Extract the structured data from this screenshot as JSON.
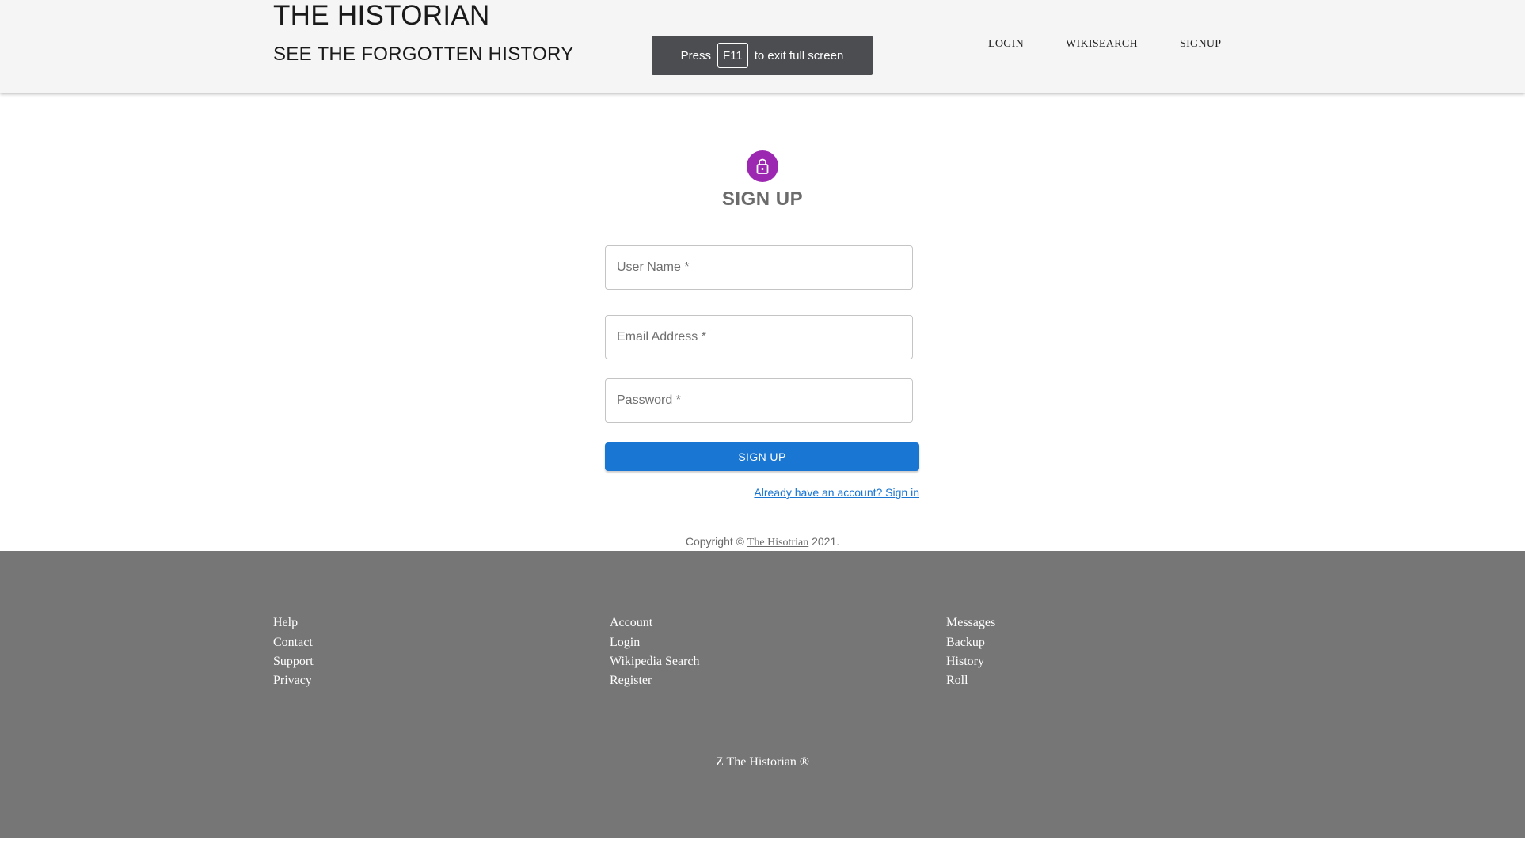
{
  "header": {
    "title": "THE HISTORIAN",
    "subtitle": "SEE THE FORGOTTEN HISTORY",
    "nav": [
      "LOGIN",
      "WIKISEARCH",
      "SIGNUP"
    ]
  },
  "fullscreen_toast": {
    "before": "Press",
    "key": "F11",
    "after": "to exit full screen"
  },
  "form": {
    "icon": "lock-icon",
    "title": "SIGN UP",
    "username_placeholder": "User Name *",
    "email_placeholder": "Email Address *",
    "password_placeholder": "Password *",
    "submit_label": "SIGN UP",
    "signin_link": "Already have an account? Sign in"
  },
  "copyright": {
    "prefix": "Copyright ©",
    "link": "The Hisotrian",
    "suffix": "2021."
  },
  "footer": {
    "columns": [
      {
        "heading": "Help",
        "items": [
          "Contact",
          "Support",
          "Privacy"
        ]
      },
      {
        "heading": "Account",
        "items": [
          "Login",
          "Wikipedia Search",
          "Register"
        ]
      },
      {
        "heading": "Messages",
        "items": [
          "Backup",
          "History",
          "Roll"
        ]
      }
    ],
    "brand": "Z The Historian ®"
  },
  "colors": {
    "header_bg": "#f5f5f5",
    "avatar": "#9c27b0",
    "primary": "#1976d2",
    "footer_bg": "#767676",
    "toast_bg": "#4b4d50"
  }
}
